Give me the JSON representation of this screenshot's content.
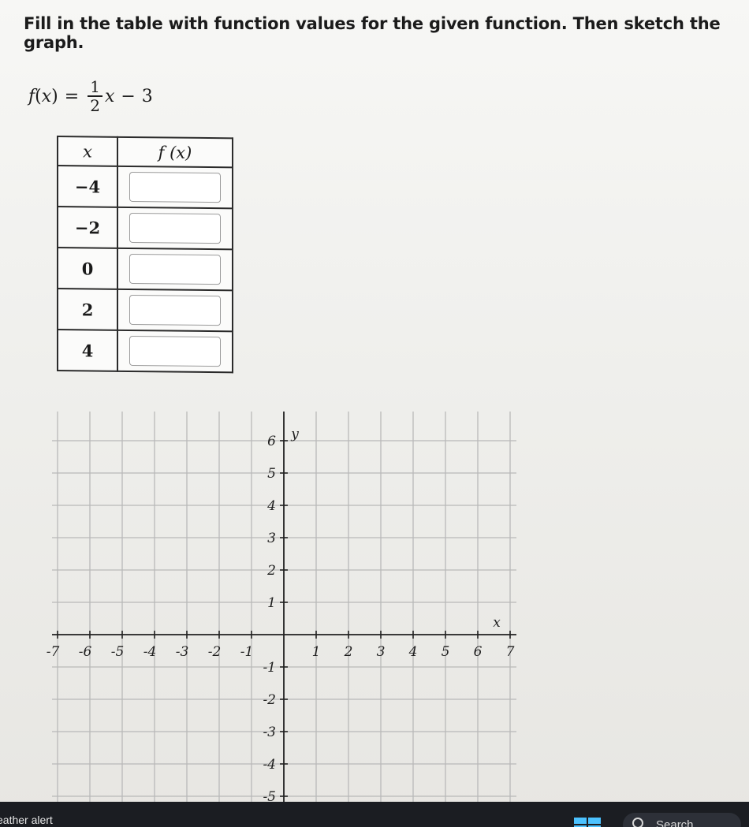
{
  "question": {
    "instructions": "Fill in the table with function values for the given function. Then sketch the graph.",
    "function": {
      "name": "f",
      "variable": "x",
      "numerator": "1",
      "denominator": "2",
      "minus": "−",
      "constant": "3"
    }
  },
  "table": {
    "x_header": "x",
    "fx_header": "f (x)",
    "rows": [
      {
        "x": "−4",
        "value": ""
      },
      {
        "x": "−2",
        "value": ""
      },
      {
        "x": "0",
        "value": ""
      },
      {
        "x": "2",
        "value": ""
      },
      {
        "x": "4",
        "value": ""
      }
    ]
  },
  "graph": {
    "x_label": "x",
    "y_label": "y",
    "x_range": [
      -7,
      7
    ],
    "y_range": [
      -5,
      6
    ],
    "x_ticks": [
      "-7",
      "-6",
      "-5",
      "-4",
      "-3",
      "-2",
      "-1",
      "1",
      "2",
      "3",
      "4",
      "5",
      "6",
      "7"
    ],
    "y_ticks_positive": [
      "6",
      "5",
      "4",
      "3",
      "2",
      "1"
    ],
    "y_ticks_negative": [
      "-1",
      "-2",
      "-3",
      "-4",
      "-5"
    ],
    "grid": true,
    "grid_color": "#b9b9b9",
    "axis_color": "#222222"
  },
  "taskbar": {
    "weather_text": "eather alert",
    "search_label": "Search",
    "start_icon": "windows-start-icon",
    "search_icon": "search-icon",
    "accent_color": "#4cc2ff"
  }
}
